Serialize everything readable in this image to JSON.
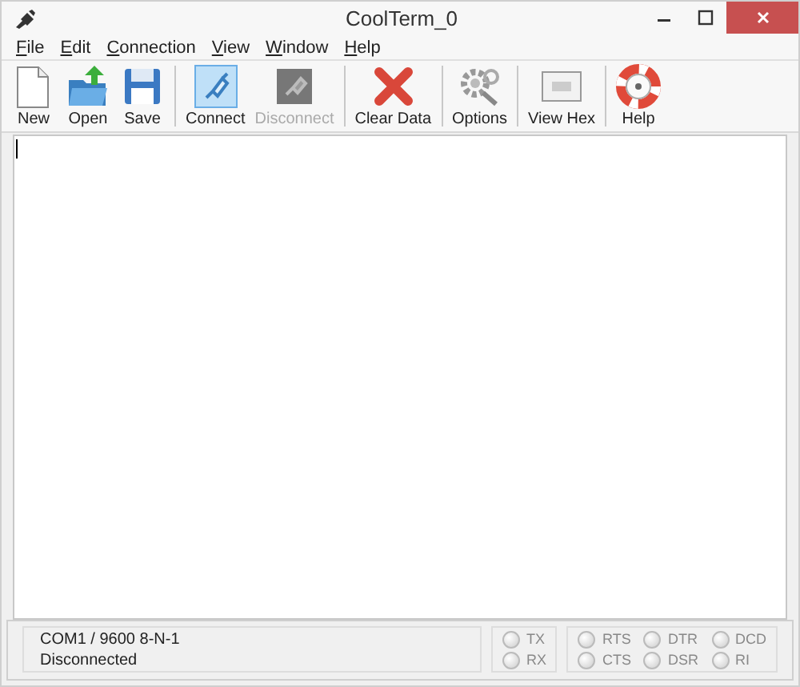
{
  "window": {
    "title": "CoolTerm_0"
  },
  "menu": [
    {
      "label": "File"
    },
    {
      "label": "Edit"
    },
    {
      "label": "Connection"
    },
    {
      "label": "View"
    },
    {
      "label": "Window"
    },
    {
      "label": "Help"
    }
  ],
  "toolbar": [
    [
      {
        "kind": "new",
        "label": "New",
        "disabled": false,
        "pressed": false
      },
      {
        "kind": "open",
        "label": "Open",
        "disabled": false,
        "pressed": false
      },
      {
        "kind": "save",
        "label": "Save",
        "disabled": false,
        "pressed": false
      }
    ],
    [
      {
        "kind": "connect",
        "label": "Connect",
        "disabled": false,
        "pressed": true
      },
      {
        "kind": "disconnect",
        "label": "Disconnect",
        "disabled": true,
        "pressed": false
      }
    ],
    [
      {
        "kind": "clear",
        "label": "Clear Data",
        "disabled": false,
        "pressed": false
      }
    ],
    [
      {
        "kind": "options",
        "label": "Options",
        "disabled": false,
        "pressed": false
      }
    ],
    [
      {
        "kind": "hex",
        "label": "View Hex",
        "disabled": false,
        "pressed": false
      }
    ],
    [
      {
        "kind": "help",
        "label": "Help",
        "disabled": false,
        "pressed": false
      }
    ]
  ],
  "status_bar": {
    "port": "COM1 / 9600 8-N-1",
    "state": "Disconnected",
    "lines": [
      [
        {
          "label": "TX",
          "on": false
        },
        {
          "label": "RX",
          "on": false
        }
      ],
      [
        {
          "label": "RTS",
          "on": false
        },
        {
          "label": "CTS",
          "on": false
        }
      ],
      [
        {
          "label": "DTR",
          "on": false
        },
        {
          "label": "DSR",
          "on": false
        }
      ],
      [
        {
          "label": "DCD",
          "on": false
        },
        {
          "label": "RI",
          "on": false
        }
      ]
    ]
  }
}
